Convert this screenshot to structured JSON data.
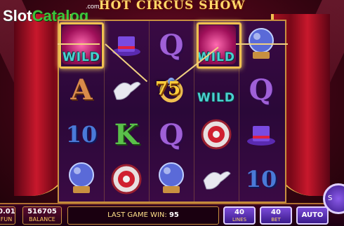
{
  "title": "HOT CIRCUS SHOW",
  "watermark": {
    "slot": "Slot",
    "catalog": "Catalog",
    "com": ".com"
  },
  "reels": [
    {
      "symbols": [
        "WILD",
        "A",
        "10",
        "crystal-ball"
      ]
    },
    {
      "symbols": [
        "magic-hat",
        "dove",
        "K",
        "target"
      ]
    },
    {
      "symbols": [
        "Q",
        "gold-ring",
        "Q",
        "crystal-ball"
      ]
    },
    {
      "symbols": [
        "WILD",
        "WILD",
        "target",
        "dove"
      ]
    },
    {
      "symbols": [
        "crystal-ball",
        "Q",
        "magic-hat",
        "10"
      ]
    }
  ],
  "wild_label": "WILD",
  "win_amount": "75",
  "bottom": {
    "fun": {
      "value": "0.01",
      "label": "FUN"
    },
    "balance": {
      "value": "516705",
      "label": "BALANCE"
    },
    "last_game_label": "LAST GAME  WIN:",
    "last_game_value": "95",
    "lines": {
      "value": "40",
      "label": "LINES"
    },
    "bet": {
      "value": "40",
      "label": "BET"
    },
    "auto_label": "AUTO",
    "spin_label": "S"
  },
  "colors": {
    "gold": "#f0c050",
    "wild": "#4ad0d0",
    "button": "#5a2ab0"
  }
}
